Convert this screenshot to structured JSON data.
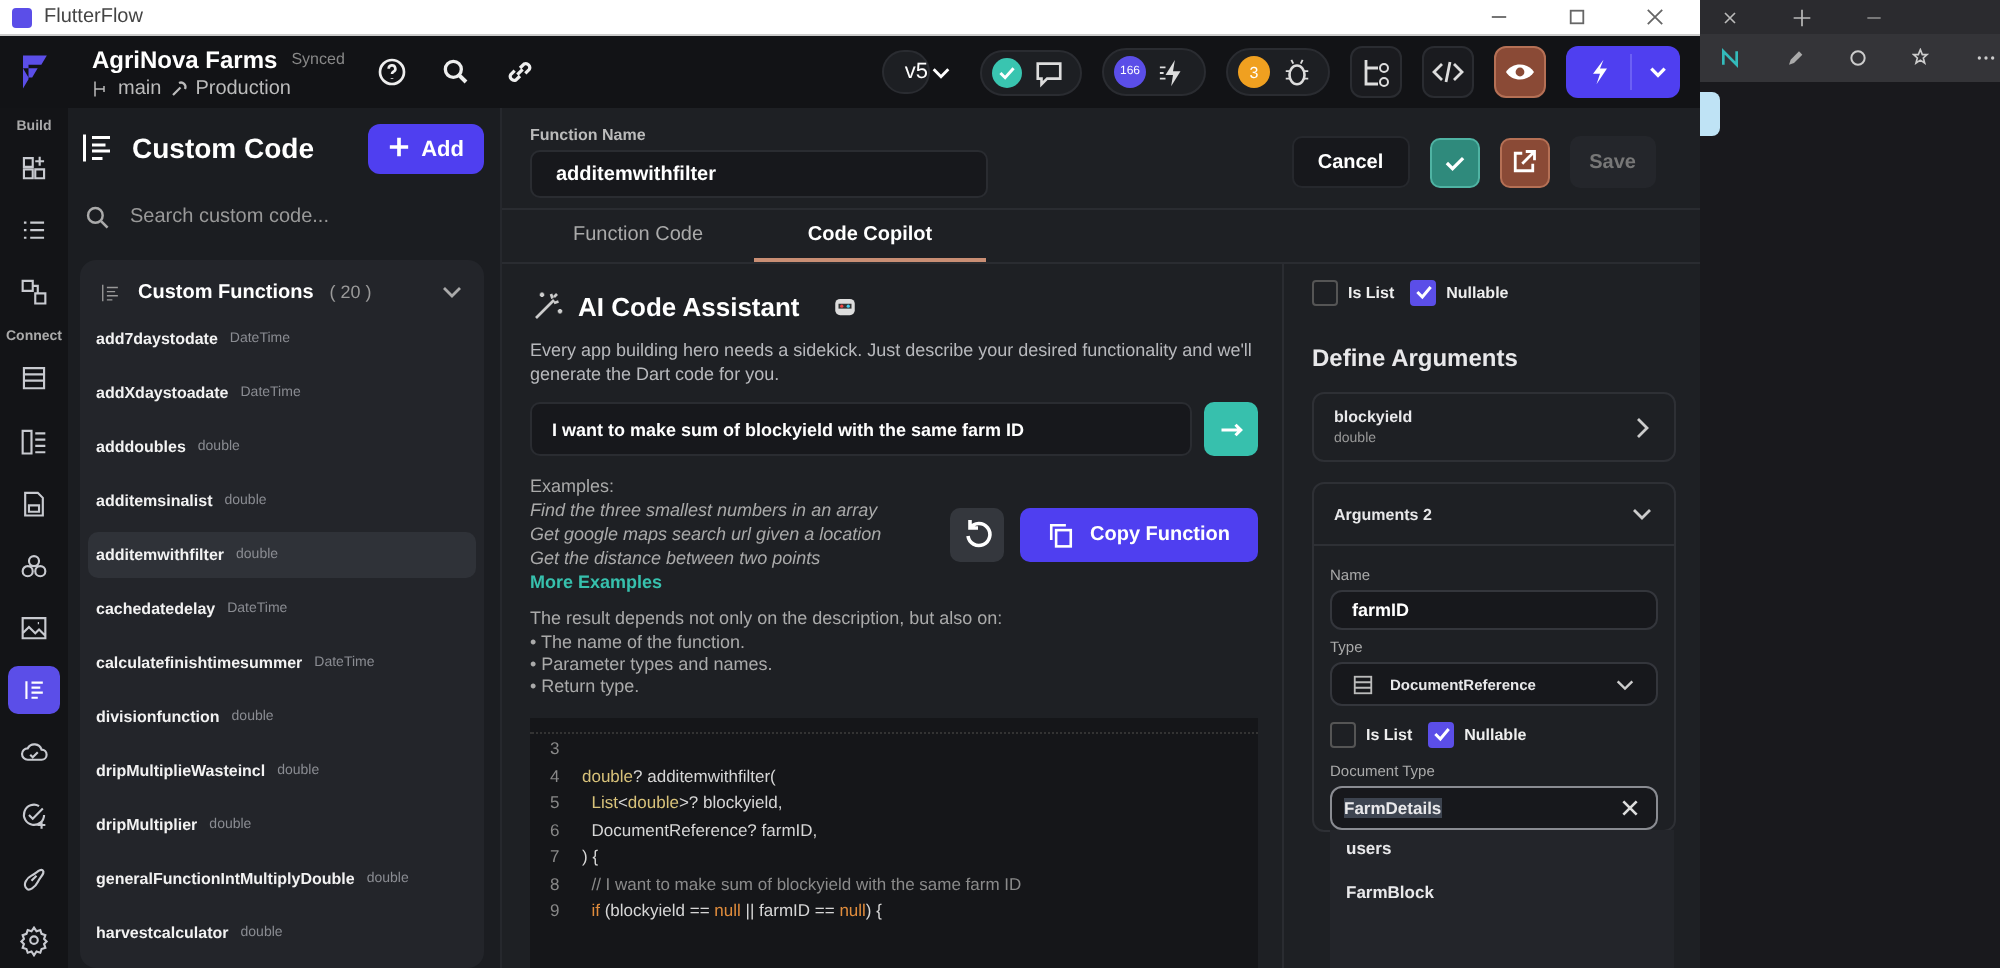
{
  "window": {
    "title": "FlutterFlow"
  },
  "project": {
    "name": "AgriNova Farms",
    "sync_status": "Synced",
    "branch": "main",
    "environment": "Production"
  },
  "toolbar": {
    "version": "v5",
    "deploy_count": "166",
    "issue_count": "3"
  },
  "rail": [
    {
      "label": "Build",
      "items": [
        {
          "selected": false
        },
        {
          "selected": false
        },
        {
          "selected": false
        }
      ]
    },
    {
      "label": "Connect",
      "items": [
        {
          "selected": false
        },
        {
          "selected": false
        },
        {
          "selected": false
        },
        {
          "selected": false
        },
        {
          "selected": false
        },
        {
          "selected": true
        },
        {
          "selected": false
        },
        {
          "selected": false
        },
        {
          "selected": false
        },
        {
          "selected": false
        }
      ]
    }
  ],
  "panel": {
    "title": "Custom Code",
    "add_button": "Add",
    "search": {
      "placeholder": "Search custom code..."
    },
    "section": {
      "title": "Custom Functions",
      "count": "( 20 )",
      "expanded": true
    },
    "functions": [
      {
        "name": "add7daystodate",
        "type": "DateTime",
        "selected": false
      },
      {
        "name": "addXdaystoadate",
        "type": "DateTime",
        "selected": false
      },
      {
        "name": "adddoubles",
        "type": "double",
        "selected": false
      },
      {
        "name": "additemsinalist",
        "type": "double",
        "selected": false
      },
      {
        "name": "additemwithfilter",
        "type": "double",
        "selected": true
      },
      {
        "name": "cachedatedelay",
        "type": "DateTime",
        "selected": false
      },
      {
        "name": "calculatefinishtimesummer",
        "type": "DateTime",
        "selected": false
      },
      {
        "name": "divisionfunction",
        "type": "double",
        "selected": false
      },
      {
        "name": "dripMultiplieWasteincl",
        "type": "double",
        "selected": false
      },
      {
        "name": "dripMultiplier",
        "type": "double",
        "selected": false
      },
      {
        "name": "generalFunctionIntMultiplyDouble",
        "type": "double",
        "selected": false
      },
      {
        "name": "harvestcalculator",
        "type": "double",
        "selected": false
      }
    ]
  },
  "editor": {
    "function_name_label": "Function Name",
    "function_name": "additemwithfilter",
    "cancel_button": "Cancel",
    "save_button": "Save",
    "tabs": [
      {
        "label": "Function Code",
        "selected": false
      },
      {
        "label": "Code Copilot",
        "selected": true
      }
    ]
  },
  "copilot": {
    "title": "AI Code Assistant",
    "description": "Every app building hero needs a sidekick. Just describe your desired functionality and we'll generate the Dart code for you.",
    "prompt": "I want to make sum of blockyield with the same farm ID",
    "examples_label": "Examples:",
    "examples": [
      "Find the three smallest numbers in an array",
      "Get google maps search url given a location",
      "Get the distance between two points"
    ],
    "more_examples": "More Examples",
    "copy_button": "Copy Function",
    "notes_intro": "The result depends not only on the description, but also on:",
    "notes": [
      "• The name of the function.",
      "• Parameter types and names.",
      "• Return type."
    ],
    "code": [
      {
        "line": "3"
      },
      {
        "line": "4",
        "tokens": [
          {
            "text": "double",
            "kind": "type"
          },
          {
            "text": "? additemwithfilter(",
            "kind": "plain"
          }
        ]
      },
      {
        "line": "5",
        "tokens": [
          {
            "text": "  List",
            "kind": "type"
          },
          {
            "text": "<",
            "kind": "plain"
          },
          {
            "text": "double",
            "kind": "type"
          },
          {
            "text": ">? blockyield,",
            "kind": "plain"
          }
        ]
      },
      {
        "line": "6",
        "tokens": [
          {
            "text": "  DocumentReference? farmID,",
            "kind": "plain"
          }
        ]
      },
      {
        "line": "7",
        "tokens": [
          {
            "text": ") {",
            "kind": "plain"
          }
        ]
      },
      {
        "line": "8",
        "tokens": [
          {
            "text": "  // I want to make sum of blockyield with the same farm ID",
            "kind": "comment"
          }
        ]
      },
      {
        "line": "9",
        "tokens": [
          {
            "text": "  if",
            "kind": "keyword"
          },
          {
            "text": " (blockyield == ",
            "kind": "plain"
          },
          {
            "text": "null",
            "kind": "keyword"
          },
          {
            "text": " || farmID == ",
            "kind": "plain"
          },
          {
            "text": "null",
            "kind": "keyword"
          },
          {
            "text": ") {",
            "kind": "plain"
          }
        ]
      }
    ]
  },
  "arguments": {
    "return_options": [
      {
        "label": "Is List",
        "checked": false
      },
      {
        "label": "Nullable",
        "checked": true
      }
    ],
    "title": "Define Arguments",
    "items": [
      {
        "title": "blockyield",
        "subtitle": "double",
        "expanded": false
      },
      {
        "title": "Arguments 2",
        "expanded": true,
        "name_label": "Name",
        "name": "farmID",
        "type_label": "Type",
        "type": "DocumentReference",
        "options": [
          {
            "label": "Is List",
            "checked": false
          },
          {
            "label": "Nullable",
            "checked": true
          }
        ],
        "document_type_label": "Document Type",
        "document_type": "FarmDetails",
        "suggestions": [
          "users",
          "FarmBlock"
        ]
      }
    ]
  }
}
